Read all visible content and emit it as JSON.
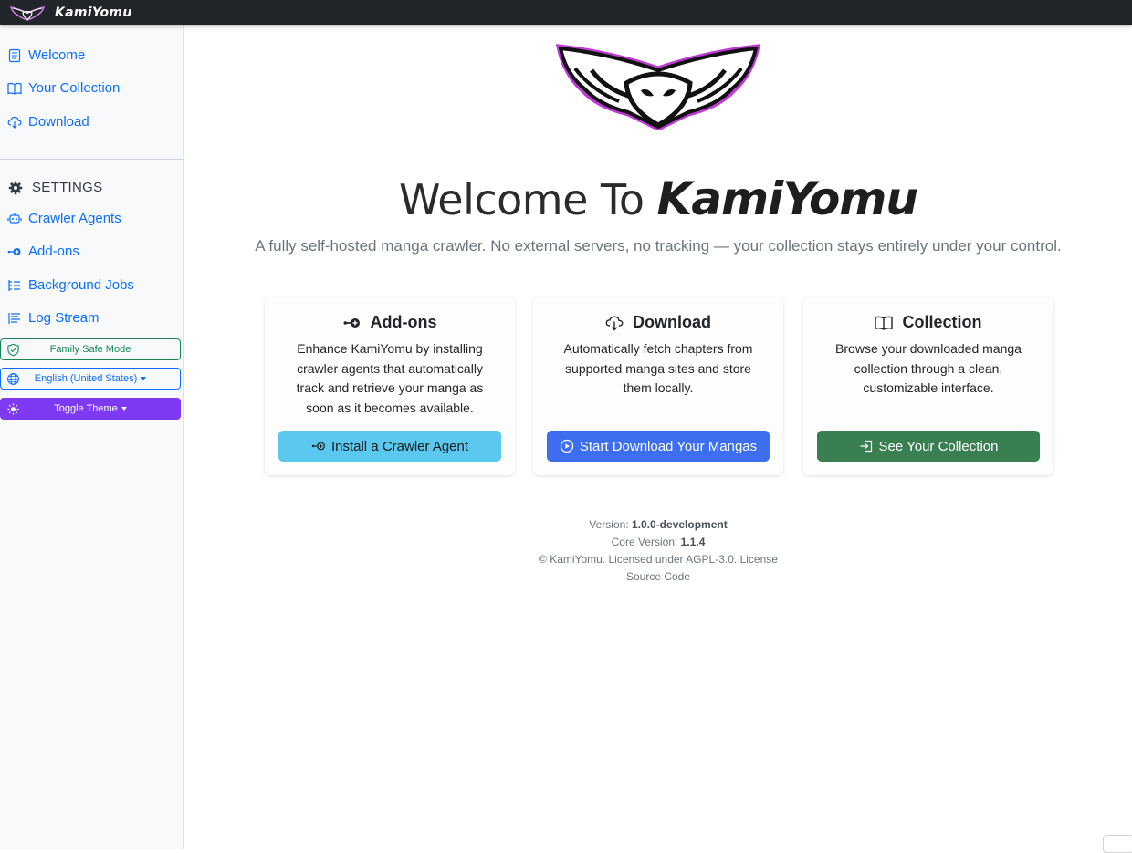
{
  "topbar": {
    "brand": "KamiYomu"
  },
  "sidebar": {
    "nav": [
      {
        "label": "Welcome",
        "icon": "journal-icon"
      },
      {
        "label": "Your Collection",
        "icon": "book-icon"
      },
      {
        "label": "Download",
        "icon": "cloud-download-icon"
      }
    ],
    "settings_label": "SETTINGS",
    "settings_items": [
      {
        "label": "Crawler Agents",
        "icon": "robot-icon"
      },
      {
        "label": "Add-ons",
        "icon": "plugin-icon"
      },
      {
        "label": "Background Jobs",
        "icon": "list-tasks-icon"
      },
      {
        "label": "Log Stream",
        "icon": "text-lines-icon"
      }
    ],
    "family_safe": "Family Safe Mode",
    "language": "English (United States)",
    "theme": "Toggle Theme"
  },
  "main": {
    "welcome_prefix": "Welcome To",
    "welcome_brand": "KamiYomu",
    "tagline": "A fully self-hosted manga crawler. No external servers, no tracking — your collection stays entirely under your control.",
    "cards": [
      {
        "title": "Add-ons",
        "icon": "plugin-icon",
        "text": "Enhance KamiYomu by installing crawler agents that automatically track and retrieve your manga as soon as it becomes available.",
        "button": "Install a Crawler Agent",
        "button_icon": "plugin-icon"
      },
      {
        "title": "Download",
        "icon": "cloud-download-icon",
        "text": "Automatically fetch chapters from supported manga sites and store them locally.",
        "button": "Start Download Your Mangas",
        "button_icon": "play-circle-icon"
      },
      {
        "title": "Collection",
        "icon": "book-icon",
        "text": "Browse your downloaded manga collection through a clean, customizable interface.",
        "button": "See Your Collection",
        "button_icon": "box-arrow-in-right-icon"
      }
    ],
    "footer": {
      "version_label": "Version:",
      "version": "1.0.0-development",
      "core_label": "Core Version:",
      "core_version": "1.1.4",
      "license": "© KamiYomu. Licensed under AGPL-3.0. License",
      "source": "Source Code"
    }
  },
  "colors": {
    "topbar": "#212529",
    "link": "#0d6efd",
    "family": "#198754",
    "theme": "#7e3af2",
    "info": "#5bc8ef",
    "primary": "#3d6ef0",
    "success": "#3a7f52"
  }
}
